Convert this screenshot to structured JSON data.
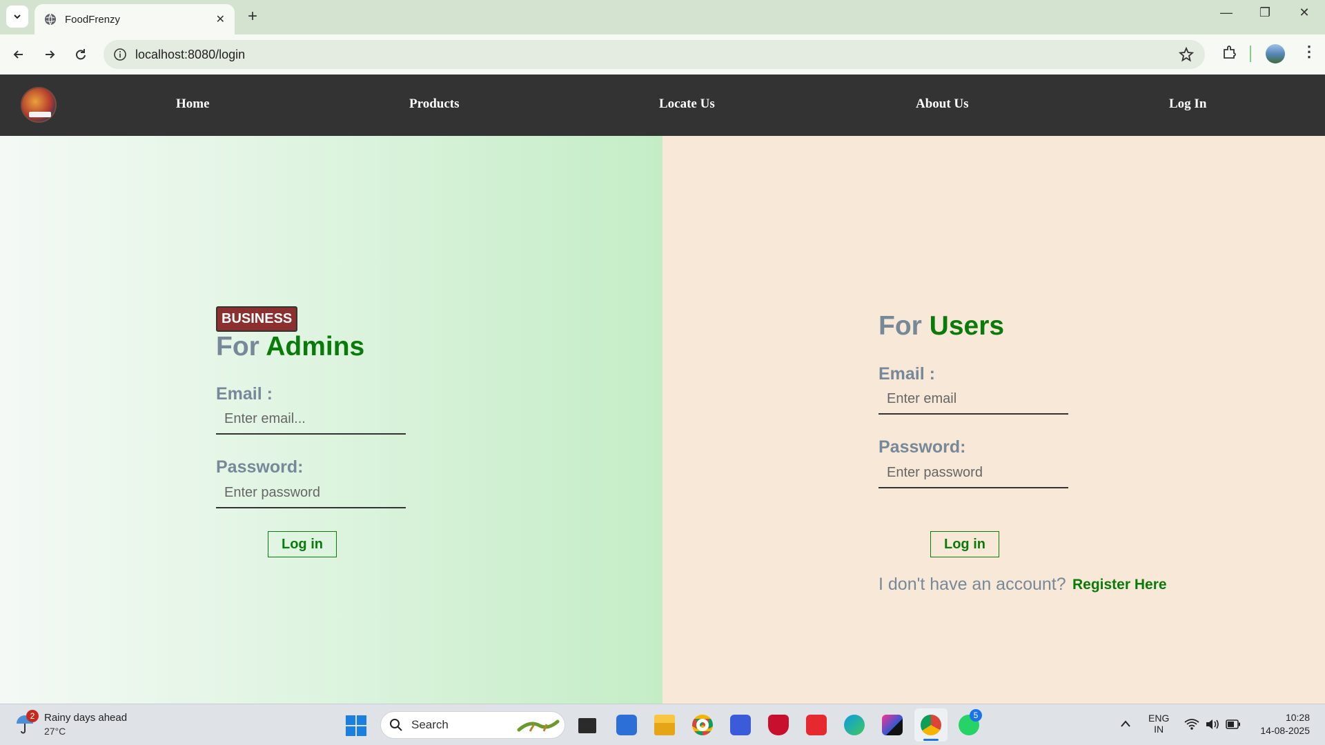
{
  "browser": {
    "tab_title": "FoodFrenzy",
    "url": "localhost:8080/login"
  },
  "nav": {
    "items": [
      "Home",
      "Products",
      "Locate Us",
      "About Us",
      "Log In"
    ]
  },
  "admin": {
    "badge": "BUSINESS",
    "heading_prefix": "For",
    "heading_accent": "Admins",
    "email_label": "Email :",
    "email_placeholder": "Enter email...",
    "password_label": "Password:",
    "password_placeholder": "Enter password",
    "login_button": "Log in"
  },
  "user": {
    "heading_prefix": "For",
    "heading_accent": "Users",
    "email_label": "Email :",
    "email_placeholder": "Enter email",
    "password_label": "Password:",
    "password_placeholder": "Enter password",
    "login_button": "Log in",
    "no_account_text": "I don't have an account?",
    "register_link": "Register Here"
  },
  "taskbar": {
    "weather_badge": "2",
    "weather_title": "Rainy days ahead",
    "weather_temp": "27°C",
    "search_label": "Search",
    "whatsapp_badge": "5",
    "lang_line1": "ENG",
    "lang_line2": "IN",
    "time": "10:28",
    "date": "14-08-2025"
  },
  "colors": {
    "accent_green": "#0a7a0a",
    "slate_text": "#778899",
    "navbar_bg": "#333333",
    "badge_bg": "#8b2f2f"
  }
}
